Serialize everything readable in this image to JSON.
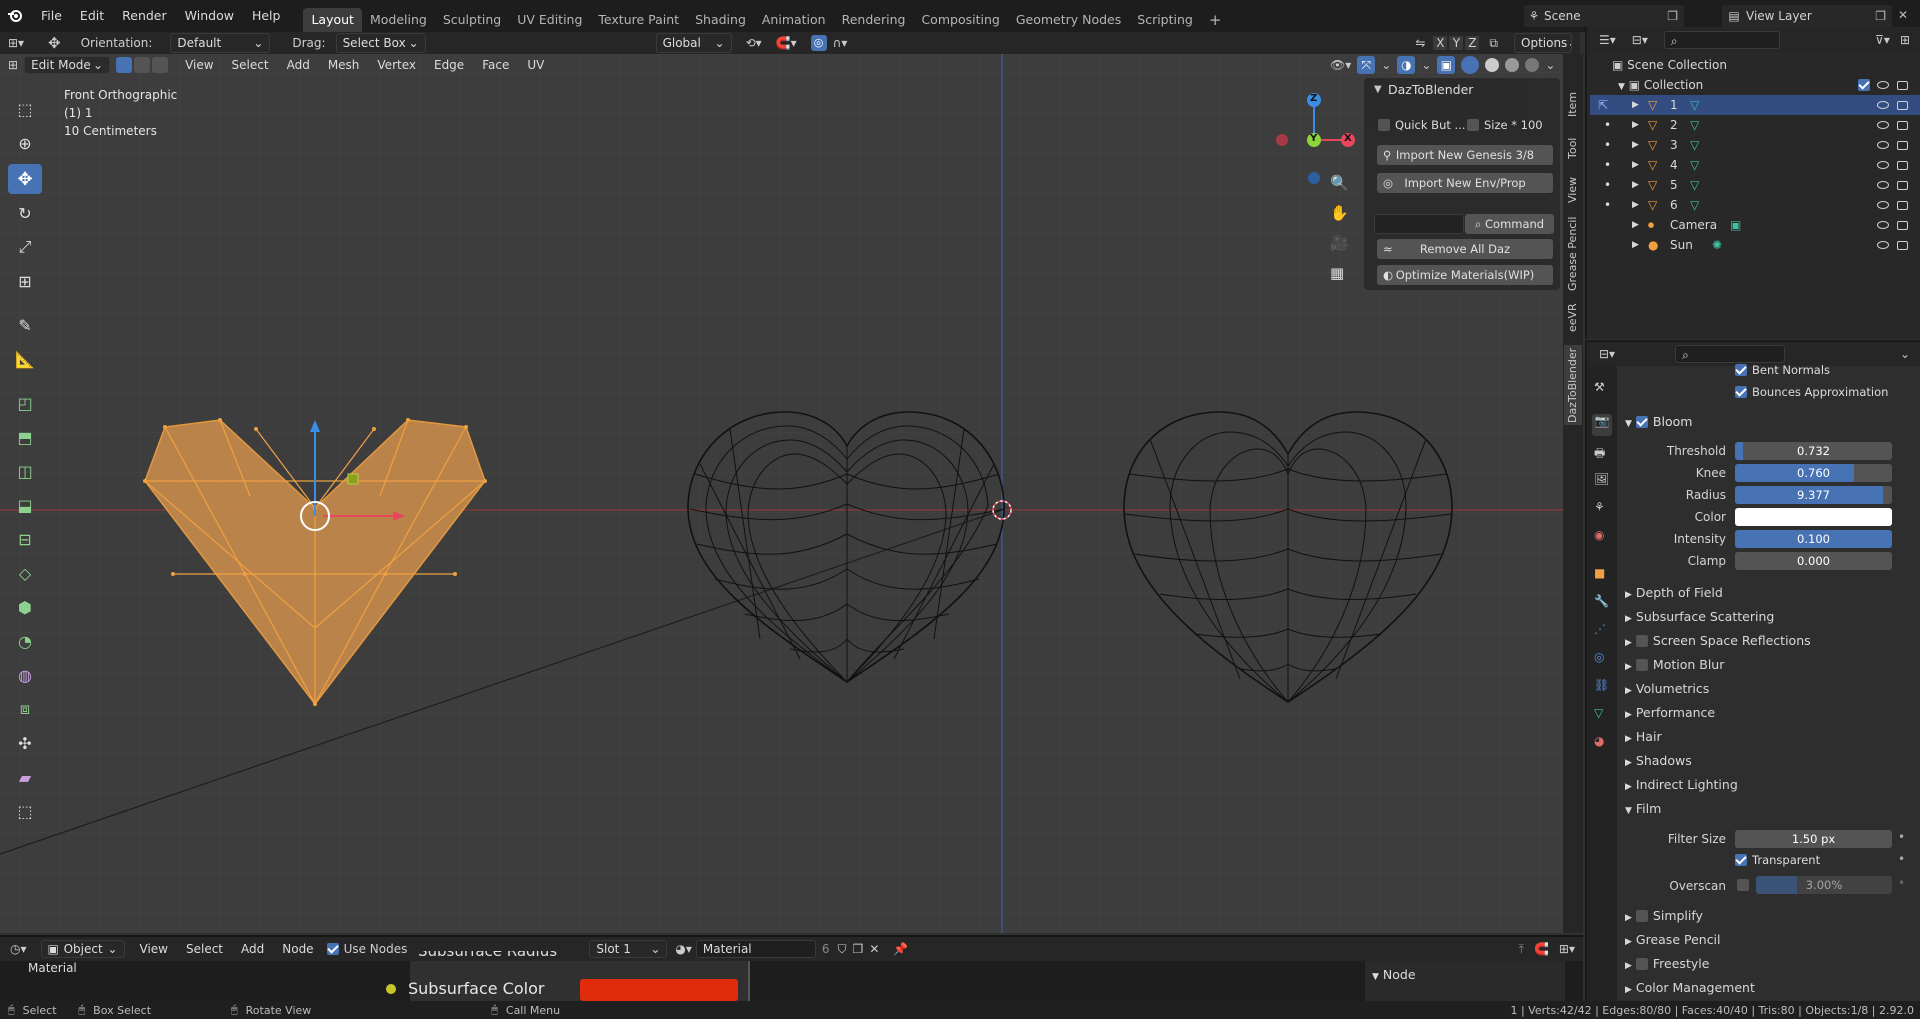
{
  "topbar": {
    "menus": [
      "File",
      "Edit",
      "Render",
      "Window",
      "Help"
    ],
    "workspaces": [
      "Layout",
      "Modeling",
      "Sculpting",
      "UV Editing",
      "Texture Paint",
      "Shading",
      "Animation",
      "Rendering",
      "Compositing",
      "Geometry Nodes",
      "Scripting"
    ],
    "scene_name": "Scene",
    "view_layer": "View Layer"
  },
  "tool_header": {
    "orientation_label": "Orientation:",
    "orientation_value": "Default",
    "drag_label": "Drag:",
    "drag_value": "Select Box",
    "transform_orientation": "Global",
    "axes": [
      "X",
      "Y",
      "Z"
    ],
    "options": "Options"
  },
  "viewport_header": {
    "mode": "Edit Mode",
    "menus": [
      "View",
      "Select",
      "Add",
      "Mesh",
      "Vertex",
      "Edge",
      "Face",
      "UV"
    ]
  },
  "overlay_text": {
    "view_name": "Front Orthographic",
    "object_info": "(1) 1",
    "scale": "10 Centimeters"
  },
  "gizmo": {
    "x": "X",
    "y": "Y",
    "z": "Z"
  },
  "daz_panel": {
    "title": "DazToBlender",
    "quick_button": "Quick But ...",
    "size_label": "Size * 100",
    "import_genesis": "Import New Genesis 3/8",
    "import_env": "Import New Env/Prop",
    "command_label": "Command",
    "remove_all": "Remove All Daz",
    "optimize": "Optimize Materials(WIP)"
  },
  "sidebar_tabs": [
    "Item",
    "Tool",
    "View",
    "Grease Pencil",
    "eeVR",
    "DazToBlender"
  ],
  "outliner": {
    "search_placeholder": "",
    "scene_collection": "Scene Collection",
    "collection": "Collection",
    "items": [
      "1",
      "2",
      "3",
      "4",
      "5",
      "6",
      "Camera",
      "Sun"
    ]
  },
  "properties": {
    "top_items": {
      "bent_normals": "Bent Normals",
      "bounces": "Bounces Approximation"
    },
    "bloom": {
      "title": "Bloom",
      "threshold_label": "Threshold",
      "threshold": "0.732",
      "threshold_fraction": 0.05,
      "knee_label": "Knee",
      "knee": "0.760",
      "knee_fraction": 0.76,
      "radius_label": "Radius",
      "radius": "9.377",
      "radius_fraction": 0.94,
      "color_label": "Color",
      "color": "#ffffff",
      "intensity_label": "Intensity",
      "intensity": "0.100",
      "intensity_fraction": 1.0,
      "clamp_label": "Clamp",
      "clamp": "0.000",
      "clamp_fraction": 0.0
    },
    "sections_a": [
      "Depth of Field",
      "Subsurface Scattering",
      "Screen Space Reflections",
      "Motion Blur",
      "Volumetrics",
      "Performance",
      "Hair",
      "Shadows",
      "Indirect Lighting",
      "Film"
    ],
    "film": {
      "filter_size_label": "Filter Size",
      "filter_size": "1.50 px",
      "transparent": "Transparent",
      "overscan_label": "Overscan",
      "overscan": "3.00%",
      "overscan_fraction": 0.3
    },
    "sections_b": [
      "Simplify",
      "Grease Pencil",
      "Freestyle",
      "Color Management"
    ]
  },
  "node_editor": {
    "object_mode": "Object",
    "menus": [
      "View",
      "Select",
      "Add",
      "Node"
    ],
    "use_nodes": "Use Nodes",
    "slot": "Slot 1",
    "material": "Material",
    "user_count": "6",
    "breadcrumb": "Material",
    "sub_radius": "Subsurface Radius",
    "sub_color": "Subsurface Color",
    "sub_color_value": "#e02c0b",
    "node_panel": "Node"
  },
  "statusbar": {
    "select": "Select",
    "box_select": "Box Select",
    "rotate": "Rotate View",
    "call_menu": "Call Menu",
    "stats": "1 | Verts:42/42 | Edges:80/80 | Faces:40/40 | Tris:80 | Objects:1/8 | 2.92.0"
  },
  "colors": {
    "accent": "#4772b3",
    "selection": "#f0a040",
    "x_axis": "#e8465a",
    "y_axis": "#8bd43b",
    "z_axis": "#3a8ee6"
  }
}
